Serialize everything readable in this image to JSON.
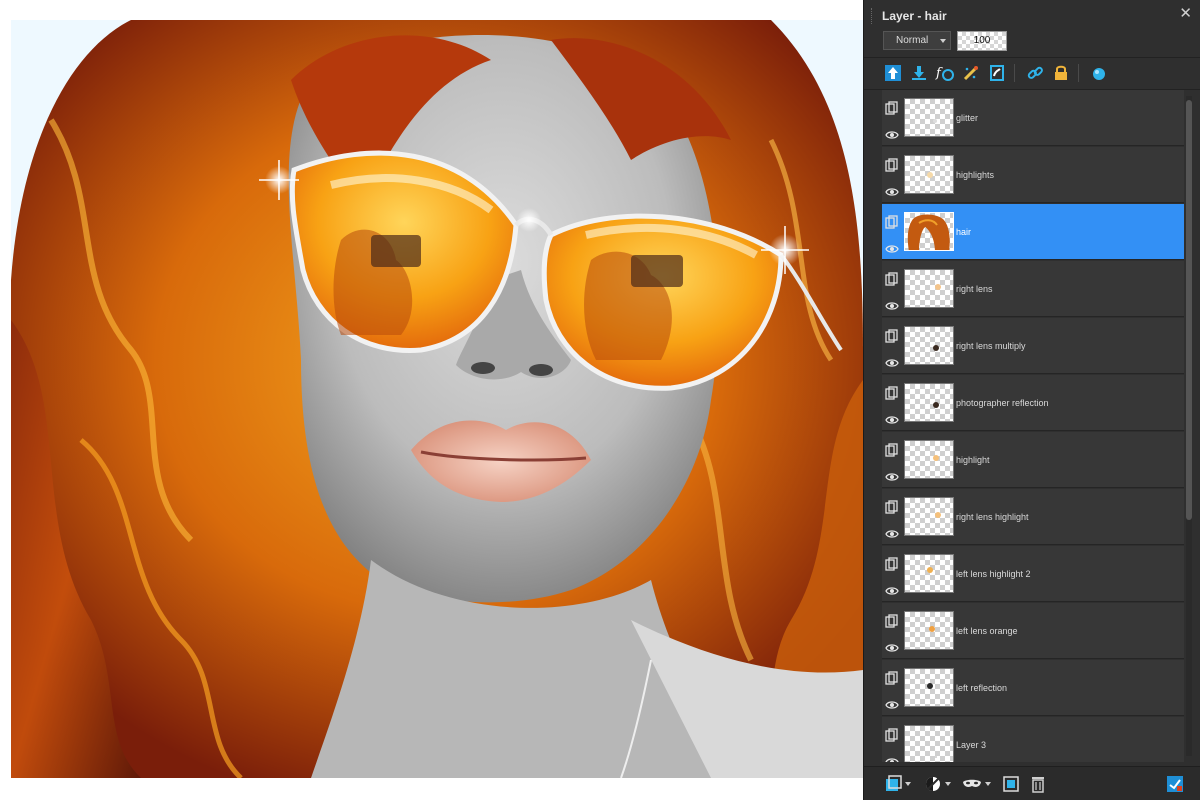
{
  "panel": {
    "title": "Layer - hair",
    "blend_mode": "Normal",
    "opacity": "100",
    "close_glyph": "✕"
  },
  "toolbar_icons": [
    "move-layer-up-icon",
    "move-layer-down-icon",
    "layer-styles-icon",
    "adjustment-icon",
    "mask-icon",
    "link-icon",
    "lock-icon",
    "fill-icon"
  ],
  "layers": [
    {
      "name": "glitter",
      "selected": false
    },
    {
      "name": "highlights",
      "selected": false
    },
    {
      "name": "hair",
      "selected": true
    },
    {
      "name": "right lens",
      "selected": false
    },
    {
      "name": "right lens multiply",
      "selected": false
    },
    {
      "name": "photographer reflection",
      "selected": false
    },
    {
      "name": "highlight",
      "selected": false
    },
    {
      "name": "right lens highlight",
      "selected": false
    },
    {
      "name": "left lens highlight 2",
      "selected": false
    },
    {
      "name": "left lens orange",
      "selected": false
    },
    {
      "name": "left reflection",
      "selected": false
    },
    {
      "name": "Layer 3",
      "selected": false
    }
  ],
  "bottom_icons": [
    "new-layer-icon",
    "adjustment-layer-icon",
    "mask-layer-icon",
    "duplicate-layer-icon",
    "delete-layer-icon",
    "panel-options-icon"
  ],
  "colors": {
    "panel_bg": "#2f2f2f",
    "row_bg": "#373737",
    "selected": "#3390f5",
    "accent_cyan": "#2fb3ea",
    "hair_orange": "#e07a10"
  }
}
